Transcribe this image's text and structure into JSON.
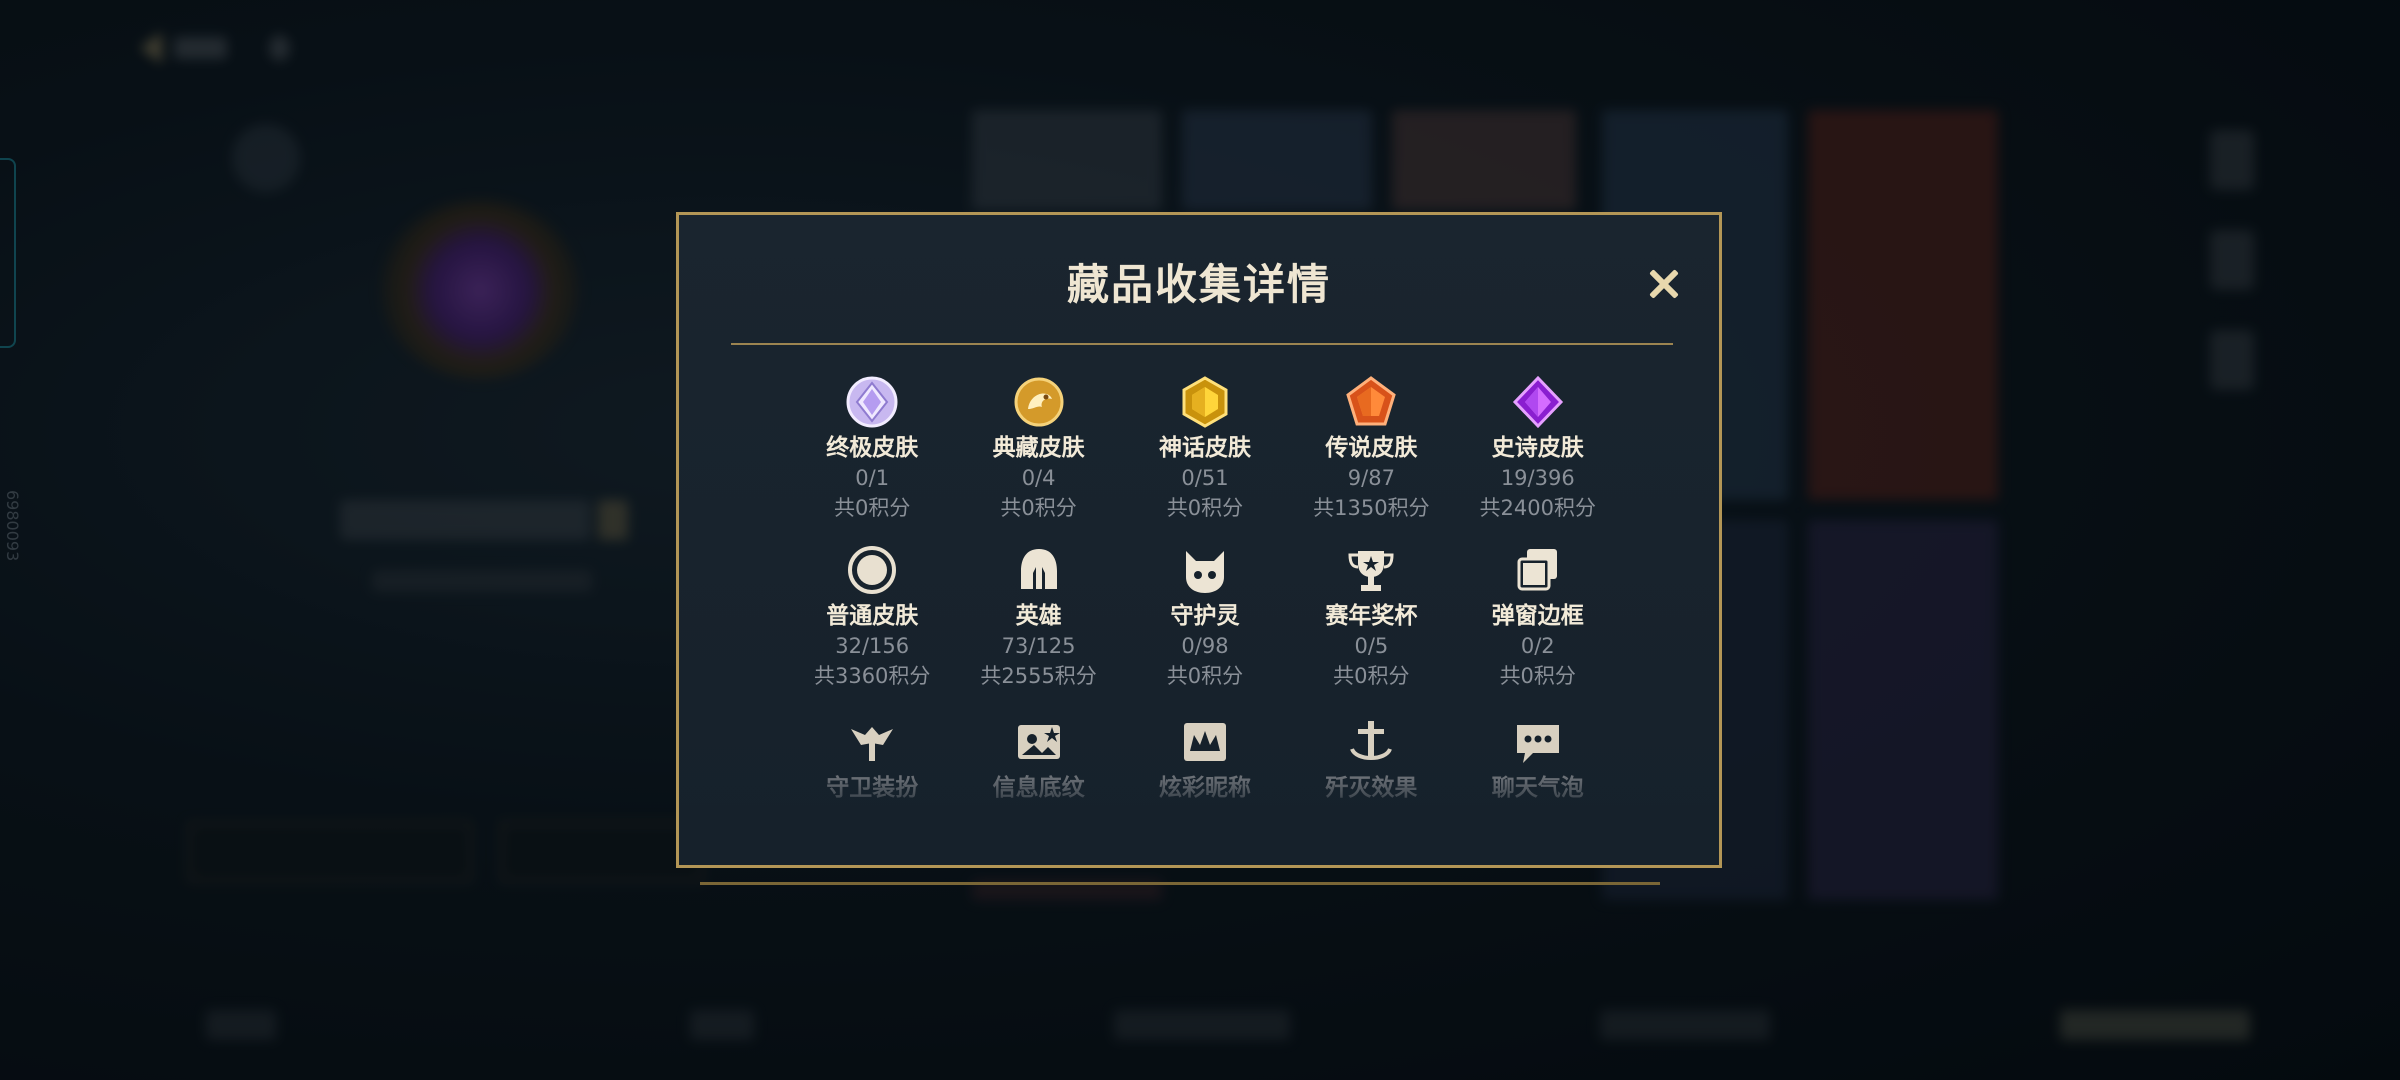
{
  "colors": {
    "accent_gold": "#b39656",
    "title_text": "#efe6d2",
    "muted_text": "#8a9098"
  },
  "modal": {
    "title": "藏品收集详情",
    "close_icon": "close-icon"
  },
  "items": [
    {
      "label": "终极皮肤",
      "count": "0/1",
      "points": "共0积分",
      "icon": "ultimate-skin-gem-icon"
    },
    {
      "label": "典藏皮肤",
      "count": "0/4",
      "points": "共0积分",
      "icon": "collection-skin-dragon-icon"
    },
    {
      "label": "神话皮肤",
      "count": "0/51",
      "points": "共0积分",
      "icon": "mythic-skin-gem-icon"
    },
    {
      "label": "传说皮肤",
      "count": "9/87",
      "points": "共1350积分",
      "icon": "legend-skin-gem-icon"
    },
    {
      "label": "史诗皮肤",
      "count": "19/396",
      "points": "共2400积分",
      "icon": "epic-skin-gem-icon"
    },
    {
      "label": "普通皮肤",
      "count": "32/156",
      "points": "共3360积分",
      "icon": "normal-skin-ring-icon"
    },
    {
      "label": "英雄",
      "count": "73/125",
      "points": "共2555积分",
      "icon": "hero-helmet-icon"
    },
    {
      "label": "守护灵",
      "count": "0/98",
      "points": "共0积分",
      "icon": "guardian-spirit-icon"
    },
    {
      "label": "赛年奖杯",
      "count": "0/5",
      "points": "共0积分",
      "icon": "trophy-icon"
    },
    {
      "label": "弹窗边框",
      "count": "0/2",
      "points": "共0积分",
      "icon": "popup-frame-icon"
    }
  ],
  "partial_items": [
    {
      "label": "守卫装扮",
      "icon": "guard-outfit-icon"
    },
    {
      "label": "信息底纹",
      "icon": "info-background-icon"
    },
    {
      "label": "炫彩昵称",
      "icon": "colorful-nickname-icon"
    },
    {
      "label": "歼灭效果",
      "icon": "kill-effect-icon"
    },
    {
      "label": "聊天气泡",
      "icon": "chat-bubble-icon"
    }
  ],
  "background": {
    "vertical_id": "6980093"
  }
}
